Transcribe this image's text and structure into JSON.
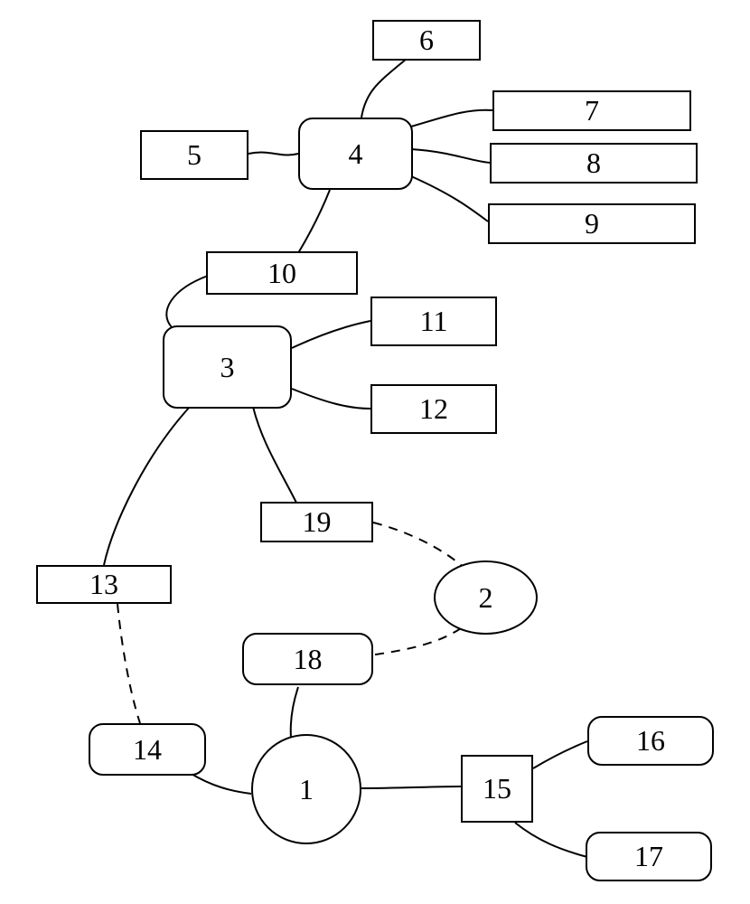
{
  "diagram": {
    "nodes": {
      "n1": {
        "label": "1"
      },
      "n2": {
        "label": "2"
      },
      "n3": {
        "label": "3"
      },
      "n4": {
        "label": "4"
      },
      "n5": {
        "label": "5"
      },
      "n6": {
        "label": "6"
      },
      "n7": {
        "label": "7"
      },
      "n8": {
        "label": "8"
      },
      "n9": {
        "label": "9"
      },
      "n10": {
        "label": "10"
      },
      "n11": {
        "label": "11"
      },
      "n12": {
        "label": "12"
      },
      "n13": {
        "label": "13"
      },
      "n14": {
        "label": "14"
      },
      "n15": {
        "label": "15"
      },
      "n16": {
        "label": "16"
      },
      "n17": {
        "label": "17"
      },
      "n18": {
        "label": "18"
      },
      "n19": {
        "label": "19"
      }
    },
    "edges": [
      {
        "from": "n4",
        "to": "n5",
        "style": "solid"
      },
      {
        "from": "n4",
        "to": "n6",
        "style": "solid"
      },
      {
        "from": "n4",
        "to": "n7",
        "style": "solid"
      },
      {
        "from": "n4",
        "to": "n8",
        "style": "solid"
      },
      {
        "from": "n4",
        "to": "n9",
        "style": "solid"
      },
      {
        "from": "n4",
        "to": "n10",
        "style": "solid"
      },
      {
        "from": "n10",
        "to": "n3",
        "style": "solid"
      },
      {
        "from": "n3",
        "to": "n11",
        "style": "solid"
      },
      {
        "from": "n3",
        "to": "n12",
        "style": "solid"
      },
      {
        "from": "n3",
        "to": "n19",
        "style": "solid"
      },
      {
        "from": "n3",
        "to": "n13",
        "style": "solid"
      },
      {
        "from": "n19",
        "to": "n2",
        "style": "dashed"
      },
      {
        "from": "n2",
        "to": "n18",
        "style": "dashed"
      },
      {
        "from": "n13",
        "to": "n14",
        "style": "dashed"
      },
      {
        "from": "n18",
        "to": "n1",
        "style": "solid"
      },
      {
        "from": "n14",
        "to": "n1",
        "style": "solid"
      },
      {
        "from": "n1",
        "to": "n15",
        "style": "solid"
      },
      {
        "from": "n15",
        "to": "n16",
        "style": "solid"
      },
      {
        "from": "n15",
        "to": "n17",
        "style": "solid"
      }
    ]
  },
  "chart_data": {
    "type": "diagram",
    "title": "",
    "shapes": [
      {
        "id": 1,
        "shape": "circle",
        "label": "1"
      },
      {
        "id": 2,
        "shape": "ellipse",
        "label": "2"
      },
      {
        "id": 3,
        "shape": "rounded-rectangle",
        "label": "3"
      },
      {
        "id": 4,
        "shape": "rounded-rectangle",
        "label": "4"
      },
      {
        "id": 5,
        "shape": "rectangle",
        "label": "5"
      },
      {
        "id": 6,
        "shape": "rectangle",
        "label": "6"
      },
      {
        "id": 7,
        "shape": "rectangle",
        "label": "7"
      },
      {
        "id": 8,
        "shape": "rectangle",
        "label": "8"
      },
      {
        "id": 9,
        "shape": "rectangle",
        "label": "9"
      },
      {
        "id": 10,
        "shape": "rectangle",
        "label": "10"
      },
      {
        "id": 11,
        "shape": "rectangle",
        "label": "11"
      },
      {
        "id": 12,
        "shape": "rectangle",
        "label": "12"
      },
      {
        "id": 13,
        "shape": "rectangle",
        "label": "13"
      },
      {
        "id": 14,
        "shape": "rounded-rectangle",
        "label": "14"
      },
      {
        "id": 15,
        "shape": "rectangle",
        "label": "15"
      },
      {
        "id": 16,
        "shape": "rounded-rectangle",
        "label": "16"
      },
      {
        "id": 17,
        "shape": "rounded-rectangle",
        "label": "17"
      },
      {
        "id": 18,
        "shape": "rounded-rectangle",
        "label": "18"
      },
      {
        "id": 19,
        "shape": "rectangle",
        "label": "19"
      }
    ],
    "connections": [
      {
        "from": 4,
        "to": 5,
        "line": "solid"
      },
      {
        "from": 4,
        "to": 6,
        "line": "solid"
      },
      {
        "from": 4,
        "to": 7,
        "line": "solid"
      },
      {
        "from": 4,
        "to": 8,
        "line": "solid"
      },
      {
        "from": 4,
        "to": 9,
        "line": "solid"
      },
      {
        "from": 4,
        "to": 10,
        "line": "solid"
      },
      {
        "from": 10,
        "to": 3,
        "line": "solid"
      },
      {
        "from": 3,
        "to": 11,
        "line": "solid"
      },
      {
        "from": 3,
        "to": 12,
        "line": "solid"
      },
      {
        "from": 3,
        "to": 13,
        "line": "solid"
      },
      {
        "from": 3,
        "to": 19,
        "line": "solid"
      },
      {
        "from": 19,
        "to": 2,
        "line": "dashed"
      },
      {
        "from": 2,
        "to": 18,
        "line": "dashed"
      },
      {
        "from": 13,
        "to": 14,
        "line": "dashed"
      },
      {
        "from": 18,
        "to": 1,
        "line": "solid"
      },
      {
        "from": 14,
        "to": 1,
        "line": "solid"
      },
      {
        "from": 1,
        "to": 15,
        "line": "solid"
      },
      {
        "from": 15,
        "to": 16,
        "line": "solid"
      },
      {
        "from": 15,
        "to": 17,
        "line": "solid"
      }
    ]
  }
}
